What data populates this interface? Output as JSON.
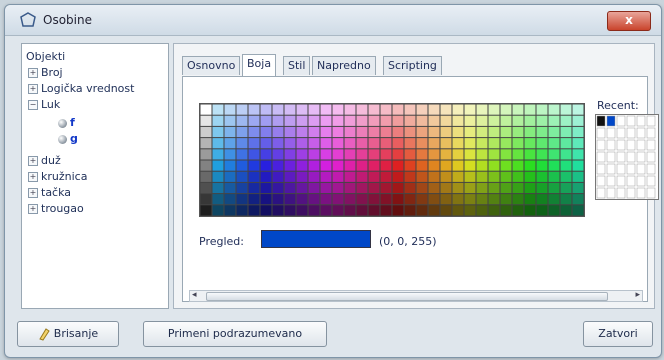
{
  "window": {
    "title": "Osobine",
    "close_label": "x"
  },
  "tree": {
    "root_label": "Objekti",
    "items": [
      {
        "label": "Broj",
        "expander": "+"
      },
      {
        "label": "Logička vrednost",
        "expander": "+"
      },
      {
        "label": "Luk",
        "expander": "−"
      },
      {
        "label": "f",
        "selected": true
      },
      {
        "label": "g",
        "selected": false
      },
      {
        "label": "duž",
        "expander": "+"
      },
      {
        "label": "kružnica",
        "expander": "+"
      },
      {
        "label": "tačka",
        "expander": "+"
      },
      {
        "label": "trougao",
        "expander": "+"
      }
    ]
  },
  "tabs": [
    "Osnovno",
    "Boja",
    "Stil",
    "Napredno",
    "Scripting"
  ],
  "active_tab": "Boja",
  "colors": {
    "recent_label": "Recent:",
    "recent_swatches": [
      "#111111",
      "#0047c8"
    ],
    "preview_label": "Pregled:",
    "preview_color": "#0047c8",
    "preview_value": "(0, 0, 255)"
  },
  "buttons": {
    "delete": "Brisanje",
    "apply_default": "Primeni podrazumevano",
    "close": "Zatvori"
  },
  "icons": {
    "title": "dialog-icon",
    "delete": "eraser-icon"
  }
}
